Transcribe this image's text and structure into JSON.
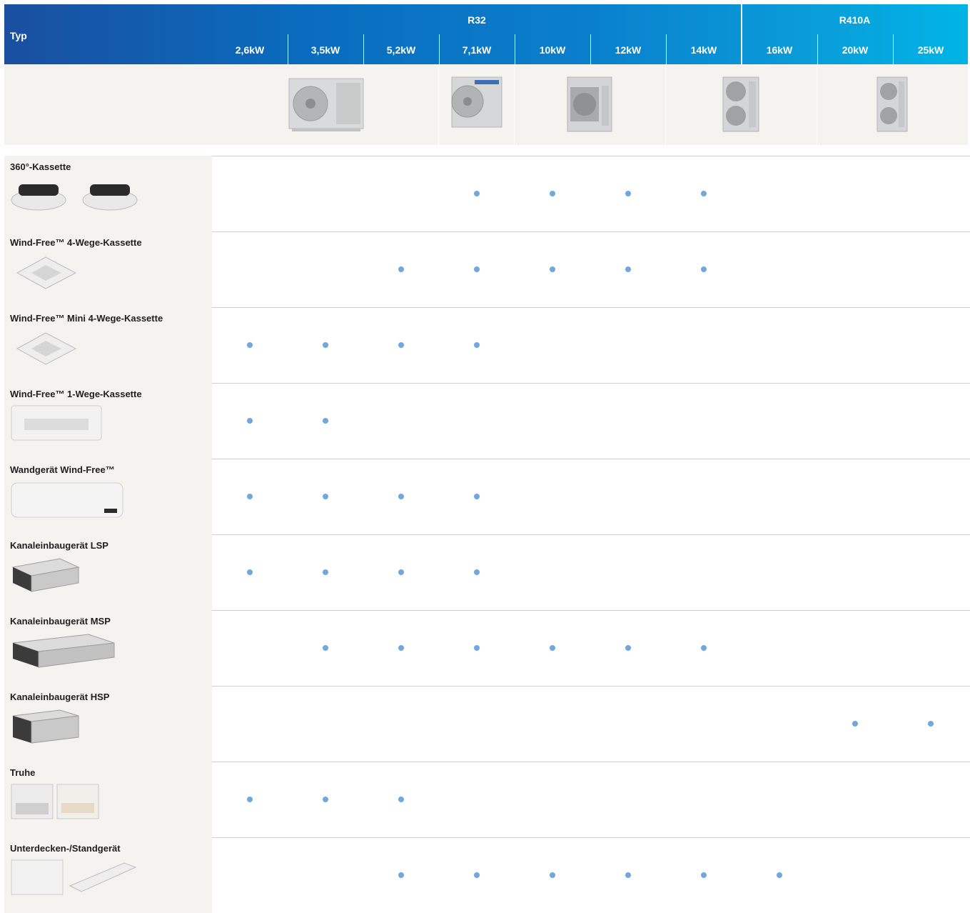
{
  "header": {
    "typ": "Typ",
    "refrigerants": [
      "R32",
      "R410A"
    ],
    "capacities": [
      "2,6kW",
      "3,5kW",
      "5,2kW",
      "7,1kW",
      "10kW",
      "12kW",
      "14kW",
      "16kW",
      "20kW",
      "25kW"
    ]
  },
  "outdoor_units": [
    {
      "name": "outdoor-unit-small-icon"
    },
    {
      "name": "outdoor-unit-medium-icon"
    },
    {
      "name": "outdoor-unit-single-fan-icon"
    },
    {
      "name": "outdoor-unit-dual-fan-icon"
    },
    {
      "name": "outdoor-unit-dual-fan-large-icon"
    }
  ],
  "rows": [
    {
      "label": "360°-Kassette",
      "availability": [
        0,
        0,
        0,
        1,
        1,
        1,
        1,
        0,
        0,
        0
      ]
    },
    {
      "label": "Wind-Free™ 4-Wege-Kassette",
      "availability": [
        0,
        0,
        1,
        1,
        1,
        1,
        1,
        0,
        0,
        0
      ]
    },
    {
      "label": "Wind-Free™ Mini 4-Wege-Kassette",
      "availability": [
        1,
        1,
        1,
        1,
        0,
        0,
        0,
        0,
        0,
        0
      ]
    },
    {
      "label": "Wind-Free™ 1-Wege-Kassette",
      "availability": [
        1,
        1,
        0,
        0,
        0,
        0,
        0,
        0,
        0,
        0
      ]
    },
    {
      "label": "Wandgerät Wind-Free™",
      "availability": [
        1,
        1,
        1,
        1,
        0,
        0,
        0,
        0,
        0,
        0
      ]
    },
    {
      "label": "Kanaleinbaugerät LSP",
      "availability": [
        1,
        1,
        1,
        1,
        0,
        0,
        0,
        0,
        0,
        0
      ]
    },
    {
      "label": "Kanaleinbaugerät MSP",
      "availability": [
        0,
        1,
        1,
        1,
        1,
        1,
        1,
        0,
        0,
        0
      ]
    },
    {
      "label": "Kanaleinbaugerät HSP",
      "availability": [
        0,
        0,
        0,
        0,
        0,
        0,
        0,
        0,
        1,
        1
      ]
    },
    {
      "label": "Truhe",
      "availability": [
        1,
        1,
        1,
        0,
        0,
        0,
        0,
        0,
        0,
        0
      ]
    },
    {
      "label": "Unterdecken-/Standgerät",
      "availability": [
        0,
        0,
        1,
        1,
        1,
        1,
        1,
        1,
        0,
        0
      ]
    }
  ],
  "colors": {
    "dot": "#6fa8dc",
    "header_start": "#1a4f9f",
    "header_end": "#00b4e6"
  }
}
